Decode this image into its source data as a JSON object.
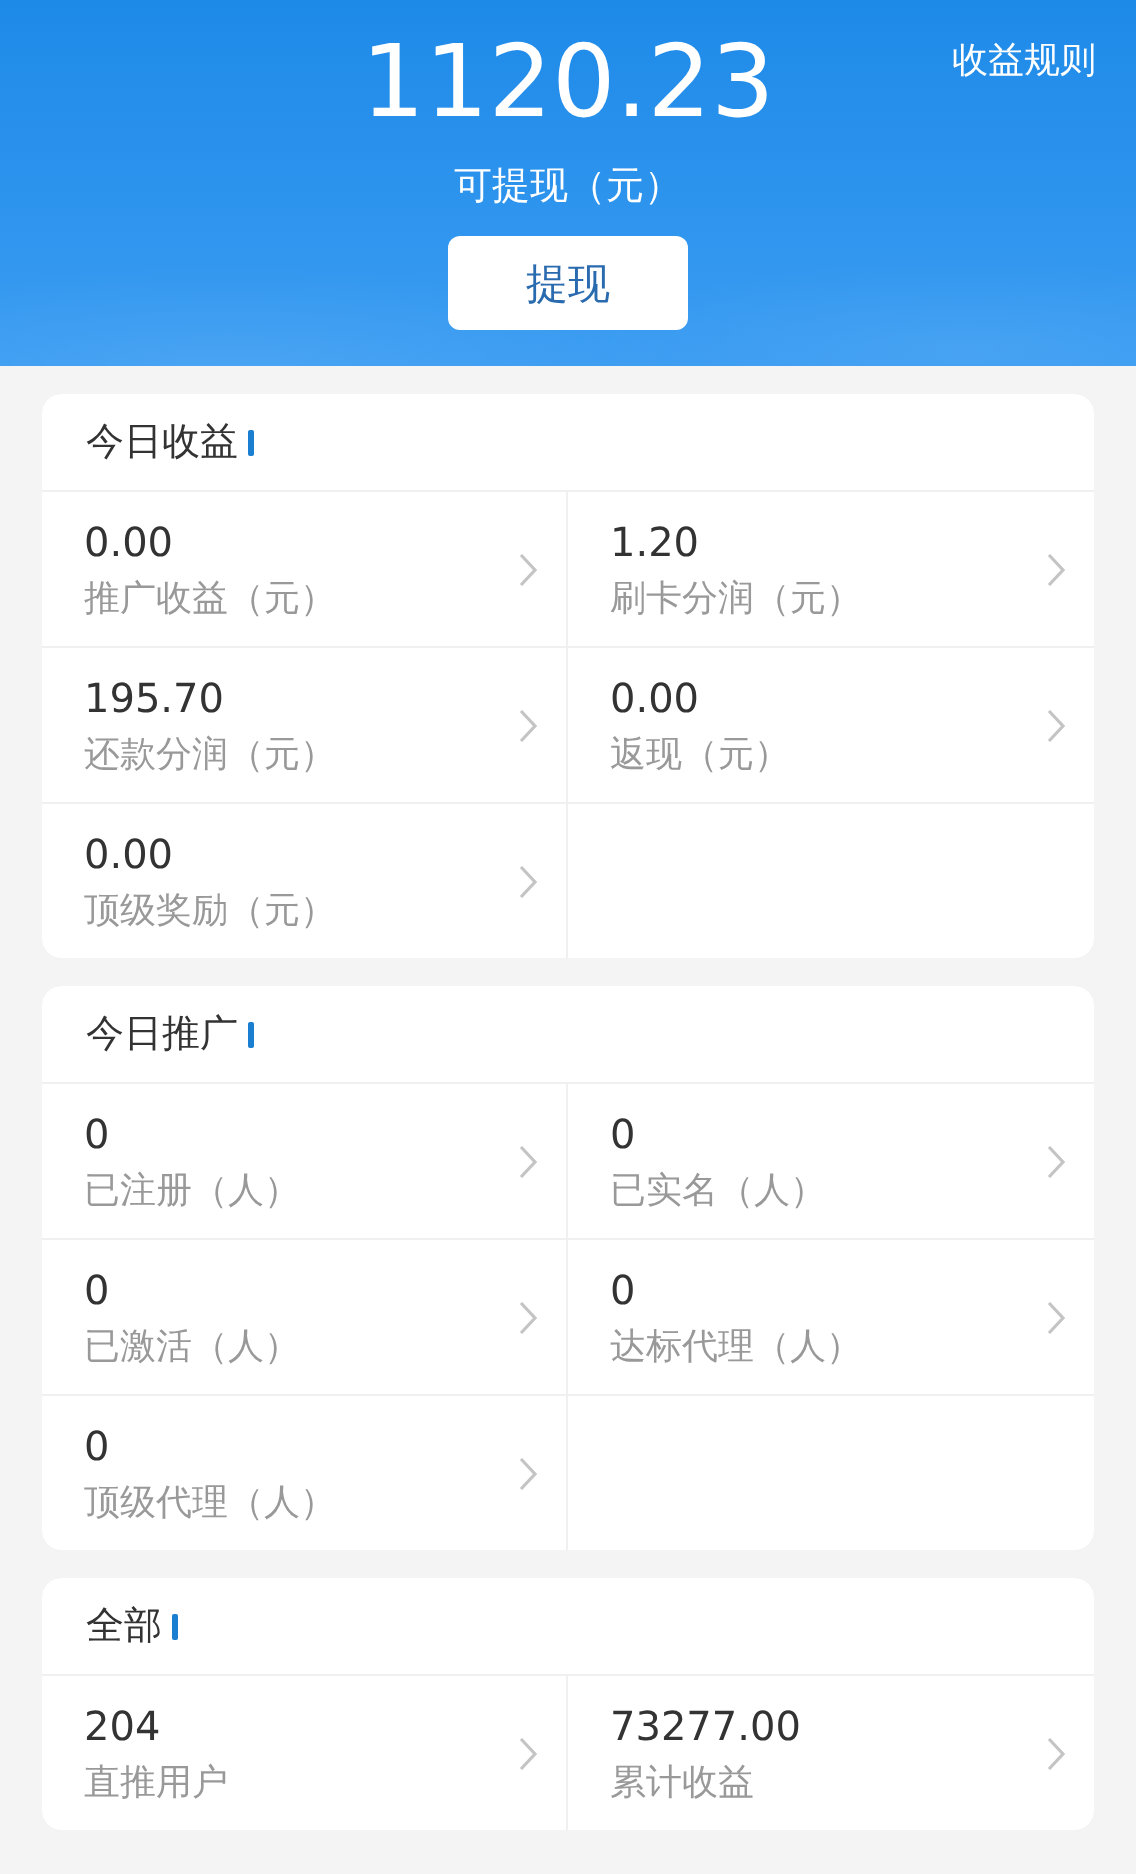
{
  "header": {
    "balance": "1120.23",
    "balance_label": "可提现（元）",
    "withdraw_button": "提现",
    "rules_link": "收益规则"
  },
  "sections": [
    {
      "title": "今日收益",
      "items": [
        {
          "value": "0.00",
          "label": "推广收益（元）"
        },
        {
          "value": "1.20",
          "label": "刷卡分润（元）"
        },
        {
          "value": "195.70",
          "label": "还款分润（元）"
        },
        {
          "value": "0.00",
          "label": "返现（元）"
        },
        {
          "value": "0.00",
          "label": "顶级奖励（元）"
        }
      ]
    },
    {
      "title": "今日推广",
      "items": [
        {
          "value": "0",
          "label": "已注册（人）"
        },
        {
          "value": "0",
          "label": "已实名（人）"
        },
        {
          "value": "0",
          "label": "已激活（人）"
        },
        {
          "value": "0",
          "label": "达标代理（人）"
        },
        {
          "value": "0",
          "label": "顶级代理（人）"
        }
      ]
    },
    {
      "title": "全部",
      "items": [
        {
          "value": "204",
          "label": "直推用户"
        },
        {
          "value": "73277.00",
          "label": "累计收益"
        }
      ]
    }
  ]
}
